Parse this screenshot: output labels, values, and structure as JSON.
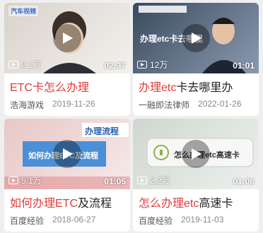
{
  "cards": [
    {
      "views": "2.1万",
      "duration": "02:37",
      "title_highlight": "ETC卡怎么办理",
      "title_rest": "",
      "source": "浩海游戏",
      "date": "2019-11-26",
      "thumb_badge": "汽车视频",
      "thumb_colors": [
        "#d9d2cb",
        "#f3f1ee"
      ]
    },
    {
      "views": "12万",
      "duration": "01:01",
      "title_highlight": "办理etc",
      "title_rest": "卡去哪里办",
      "source": "一融即法律师",
      "date": "2022-01-26",
      "thumb_caption": "办理etc卡去哪里",
      "thumb_colors": [
        "#3a4a5e",
        "#8a9ab0"
      ]
    },
    {
      "views": "5.1万",
      "duration": "01:05",
      "title_highlight": "如何办理ETC",
      "title_rest": "及流程",
      "source": "百度经验",
      "date": "2018-06-27",
      "thumb_caption": "如何办理ETC及流程",
      "thumb_banner": "办理流程",
      "thumb_colors": [
        "#d85c5c",
        "#4b8fd6"
      ]
    },
    {
      "views": "2.2万",
      "duration": "01:06",
      "title_highlight": "怎么办理etc",
      "title_rest": "高速卡",
      "source": "百度经验",
      "date": "2019-11-03",
      "thumb_caption": "怎么办理etc高速卡",
      "thumb_colors": [
        "#cfd6cf",
        "#eef1ee"
      ]
    }
  ]
}
